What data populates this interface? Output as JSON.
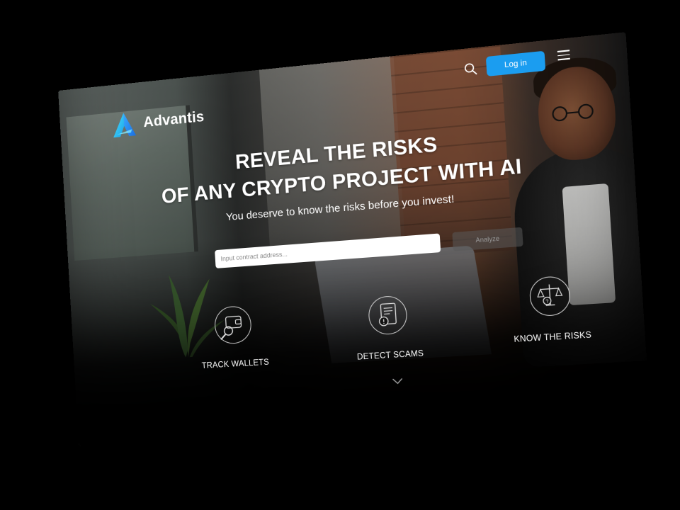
{
  "brand": {
    "name": "Advantis",
    "logo_icon": "advantis-logo-icon",
    "accent_color": "#1b9df0"
  },
  "header": {
    "search_icon": "search-icon",
    "login_label": "Log in",
    "menu_icon": "hamburger-menu-icon"
  },
  "hero": {
    "title_line1": "REVEAL THE RISKS",
    "title_line2": "OF ANY CRYPTO PROJECT WITH AI",
    "subtitle": "You deserve to know the risks before you invest!",
    "input_placeholder": "Input contract address...",
    "analyze_label": "Analyze"
  },
  "features": [
    {
      "icon": "wallet-magnifier-icon",
      "label": "TRACK WALLETS"
    },
    {
      "icon": "scam-document-icon",
      "label": "DETECT SCAMS"
    },
    {
      "icon": "risk-scale-icon",
      "label": "KNOW THE RISKS"
    }
  ],
  "scroll": {
    "icon": "chevron-down-icon"
  }
}
